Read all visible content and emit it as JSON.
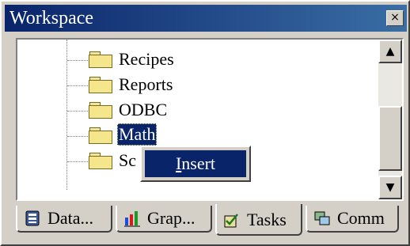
{
  "window": {
    "title": "Workspace",
    "close_label": "×"
  },
  "tree": {
    "items": [
      {
        "label": "Recipes"
      },
      {
        "label": "Reports"
      },
      {
        "label": "ODBC"
      },
      {
        "label": "Math"
      },
      {
        "label": "Sc"
      }
    ],
    "selected": "Math"
  },
  "scrollbar": {
    "up": "▲",
    "down": "▼"
  },
  "context_menu": {
    "items": [
      {
        "label": "Insert",
        "mnemonic": "I"
      }
    ]
  },
  "tabs": [
    {
      "label": "Data...",
      "icon": "database-icon"
    },
    {
      "label": "Grap...",
      "icon": "graph-icon"
    },
    {
      "label": "Tasks",
      "icon": "tasks-icon",
      "active": true
    },
    {
      "label": "Comm",
      "icon": "comm-icon"
    }
  ]
}
